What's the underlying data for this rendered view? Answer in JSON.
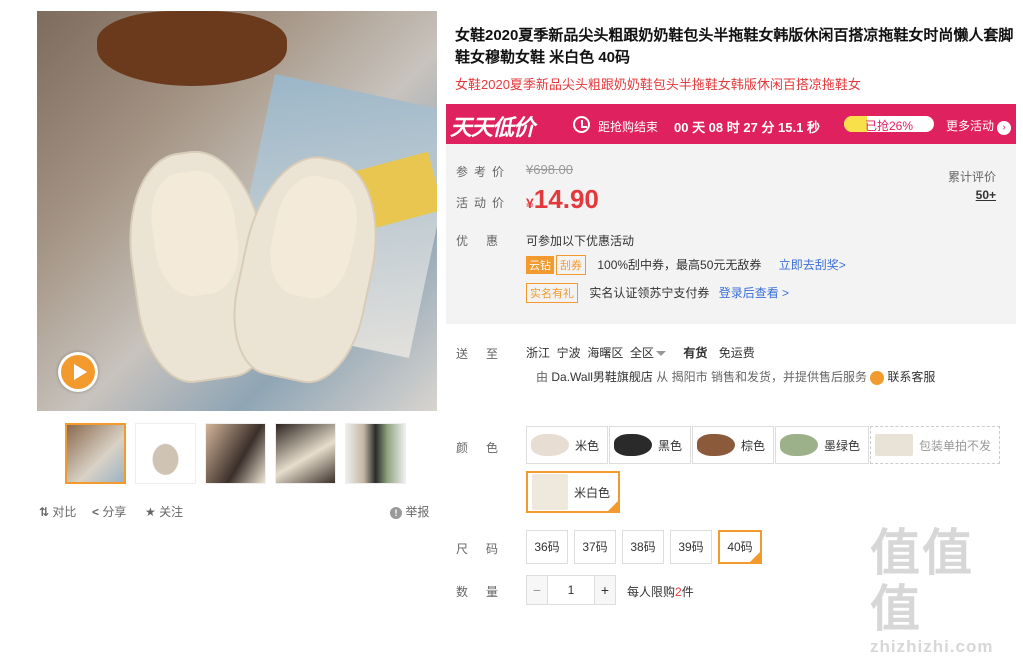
{
  "product": {
    "title": "女鞋2020夏季新品尖头粗跟奶奶鞋包头半拖鞋女韩版休闲百搭凉拖鞋女时尚懒人套脚鞋女穆勒女鞋 米白色 40码",
    "subtitle": "女鞋2020夏季新品尖头粗跟奶奶鞋包头半拖鞋女韩版休闲百搭凉拖鞋女"
  },
  "gallery": {
    "thumb_count": 5
  },
  "toolbar": {
    "compare": "对比",
    "share": "分享",
    "follow": "关注",
    "report": "举报"
  },
  "promo": {
    "logo": "天天低价",
    "countdown_label": "距抢购结束",
    "countdown": "00 天 08 时 27 分 15.1 秒",
    "progress_text": "已抢26%",
    "progress": 0.26,
    "more": "更多活动",
    "more_arrow": "›",
    "bg_color": "#e0215f"
  },
  "price": {
    "ref_label": "参考价",
    "ref_value": "¥698.00",
    "act_label": "活动价",
    "currency": "¥",
    "act_value": "14.90",
    "review_label": "累计评价",
    "review_count": "50+",
    "accent_color": "#e4393c"
  },
  "offers": {
    "label": "优惠",
    "intro": "可参加以下优惠活动",
    "tag1a": "云钻",
    "tag1b": "刮券",
    "offer1": "100%刮中券，最高50元无敌券",
    "offer1_link": "立即去刮奖>",
    "tag2": "实名有礼",
    "offer2": "实名认证领苏宁支付券",
    "offer2_link": "登录后查看 >"
  },
  "delivery": {
    "label": "送至",
    "region": "浙江  宁波  海曙区  全区",
    "stock": "有货",
    "shipping": "免运费",
    "from_prefix": "由",
    "store": "Da.Wall男鞋旗舰店",
    "from_mid": "从",
    "city": "揭阳市",
    "from_suffix": "销售和发货，并提供售后服务",
    "service": "联系客服"
  },
  "sku": {
    "color_label": "颜色",
    "colors": [
      {
        "name": "米色",
        "swatch": "#e8ddd3"
      },
      {
        "name": "黑色",
        "swatch": "#2a2a2a"
      },
      {
        "name": "棕色",
        "swatch": "#8a5a3a"
      },
      {
        "name": "墨绿色",
        "swatch": "#9cb08a"
      },
      {
        "name": "包装单拍不发",
        "swatch": "#e9e2d6"
      },
      {
        "name": "米白色",
        "swatch": "#efe8dc"
      }
    ],
    "size_label": "尺码",
    "sizes": [
      "36码",
      "37码",
      "38码",
      "39码",
      "40码"
    ],
    "qty_label": "数量",
    "qty_minus": "−",
    "qty_value": "1",
    "qty_plus": "+",
    "limit_prefix": "每人限购",
    "limit_num": "2",
    "limit_suffix": "件"
  },
  "watermark": {
    "cn": "值值值",
    "url": "zhizhizhi.com"
  }
}
